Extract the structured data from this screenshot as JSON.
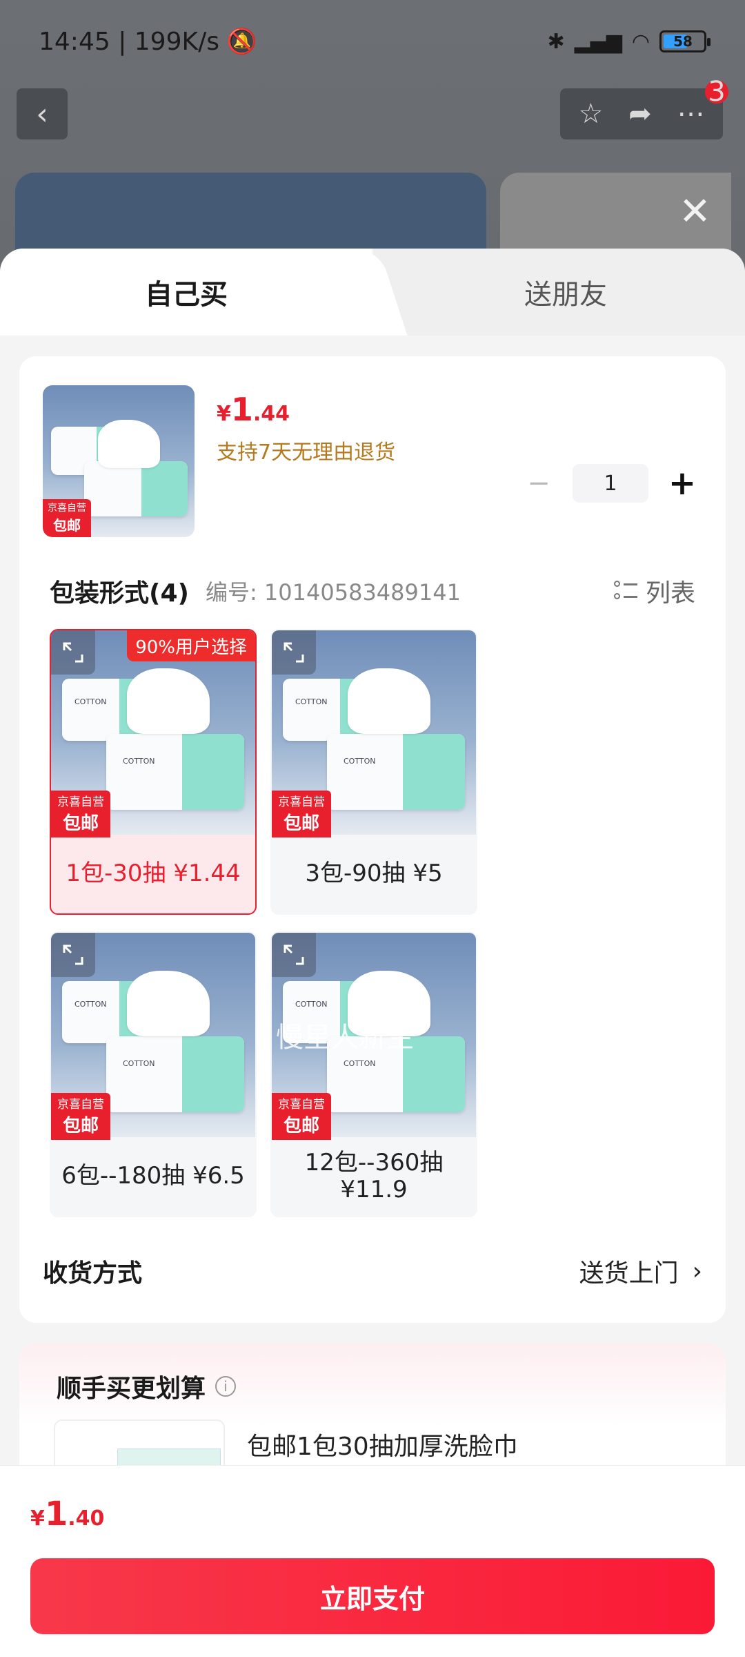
{
  "status_bar": {
    "time_speed": "14:45 | 199K/s",
    "battery": "58"
  },
  "top_nav": {
    "back_glyph": "‹",
    "badge_count": "3"
  },
  "tabs": [
    {
      "label": "自己买"
    },
    {
      "label": "送朋友"
    }
  ],
  "product": {
    "price_currency": "¥",
    "price_int": "1",
    "price_dec": ".44",
    "return_policy": "支持7天无理由退货",
    "quantity": "1",
    "jd_tag_line1": "京喜自营",
    "jd_tag_line2": "包邮"
  },
  "spec": {
    "title": "包装形式(4)",
    "code": "编号: 10140583489141",
    "list_toggle": "列表",
    "popular_tag": "90%用户选择",
    "options": [
      {
        "label": "1包-30抽  ¥1.44",
        "selected": true
      },
      {
        "label": "3包-90抽  ¥5",
        "selected": false
      },
      {
        "label": "6包--180抽  ¥6.5",
        "selected": false
      },
      {
        "label": "12包--360抽\n¥11.9",
        "selected": false
      }
    ],
    "package_brand": "COTTON"
  },
  "watermark": "慢星人新生",
  "delivery": {
    "label": "收货方式",
    "value": "送货上门"
  },
  "addon": {
    "title": "顺手买更划算",
    "item_name": "包邮1包30抽加厚洗脸巾"
  },
  "bottom": {
    "currency": "¥",
    "total_int": "1",
    "total_dec": ".40",
    "pay_label": "立即支付"
  },
  "colors": {
    "accent": "#e8202e",
    "return_note": "#b5791e",
    "selected_bg": "#fde9ec"
  }
}
